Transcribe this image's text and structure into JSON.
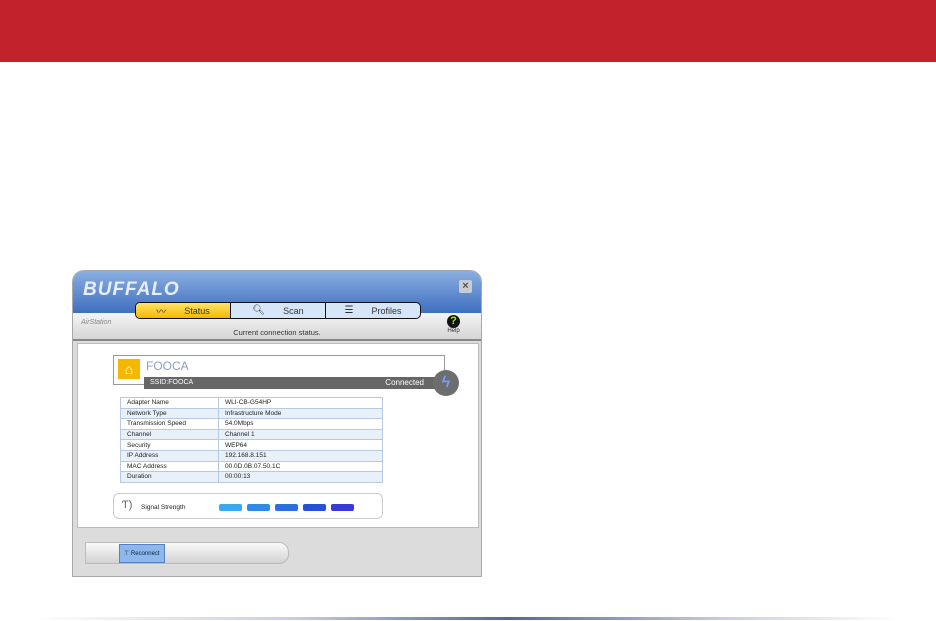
{
  "app": {
    "logo": "BUFFALO",
    "close_icon": "×",
    "brand_sub": "AirStation"
  },
  "tabs": [
    {
      "label": "Status",
      "icon": "signal-wave"
    },
    {
      "label": "Scan",
      "icon": "magnifier"
    },
    {
      "label": "Profiles",
      "icon": "document"
    }
  ],
  "header": {
    "subtitle": "Current connection status.",
    "help_label": "Help",
    "help_glyph": "?"
  },
  "profile": {
    "name": "FOOCA",
    "ssid": "SSID:FOOCA",
    "status": "Connected"
  },
  "details": [
    {
      "label": "Adapter Name",
      "value": "WLI-CB-G54HP"
    },
    {
      "label": "Network Type",
      "value": "Infrastructure Mode"
    },
    {
      "label": "Transmission Speed",
      "value": "54.0Mbps"
    },
    {
      "label": "Channel",
      "value": "Channel 1"
    },
    {
      "label": "Security",
      "value": "WEP64"
    },
    {
      "label": "IP Address",
      "value": "192.168.8.151"
    },
    {
      "label": "MAC Address",
      "value": "00.0D.0B.07.50.1C"
    },
    {
      "label": "Duration",
      "value": "00:00:13"
    }
  ],
  "signal": {
    "label": "Signal Strength",
    "level_bars": 5,
    "max_bars": 5,
    "colors": [
      "#3aa8f0",
      "#2e8ae8",
      "#2a6ee0",
      "#2650d8",
      "#3a3ad8"
    ]
  },
  "footer": {
    "reconnect_label": "Reconnect"
  },
  "colors": {
    "banner": "#c1222b",
    "active_tab": "#f5b800"
  }
}
